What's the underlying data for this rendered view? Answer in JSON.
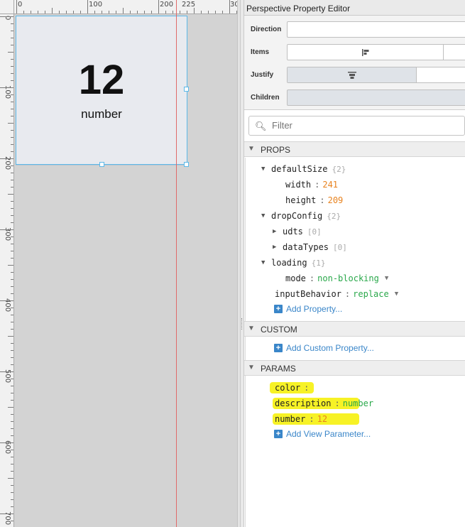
{
  "canvas": {
    "ruler_top_labels": [
      "0",
      "100",
      "200",
      "225",
      "30"
    ],
    "ruler_left_labels": [
      "0",
      "100",
      "200",
      "300",
      "400",
      "500",
      "600",
      "700"
    ],
    "view": {
      "number_text": "12",
      "label_text": "number",
      "background": "#e8eaef",
      "selection_color": "#5cb8e8"
    },
    "guide_color": "#e06a6a"
  },
  "panel": {
    "title": "Perspective Property Editor",
    "flex": {
      "direction_label": "Direction",
      "items_label": "Items",
      "justify_label": "Justify",
      "children_label": "Children"
    },
    "filter": {
      "placeholder": "Filter",
      "icon": "search-icon"
    },
    "props": {
      "title": "PROPS",
      "defaultSize": {
        "key": "defaultSize",
        "count": "{2}",
        "width": {
          "key": "width",
          "value": "241"
        },
        "height": {
          "key": "height",
          "value": "209"
        }
      },
      "dropConfig": {
        "key": "dropConfig",
        "count": "{2}",
        "udts": {
          "key": "udts",
          "count": "[0]"
        },
        "dataTypes": {
          "key": "dataTypes",
          "count": "[0]"
        }
      },
      "loading": {
        "key": "loading",
        "count": "{1}",
        "mode": {
          "key": "mode",
          "value": "non-blocking"
        }
      },
      "inputBehavior": {
        "key": "inputBehavior",
        "value": "replace"
      },
      "add_label": "Add Property..."
    },
    "custom": {
      "title": "CUSTOM",
      "add_label": "Add Custom Property..."
    },
    "params": {
      "title": "PARAMS",
      "color": {
        "key": "color",
        "value": ""
      },
      "description": {
        "key": "description",
        "value": "number"
      },
      "number": {
        "key": "number",
        "value": "12"
      },
      "add_label": "Add View Parameter..."
    },
    "colors": {
      "number_value": "#e8821e",
      "string_value": "#29a84a",
      "link": "#3a86c9",
      "highlight": "#f6f000"
    }
  }
}
